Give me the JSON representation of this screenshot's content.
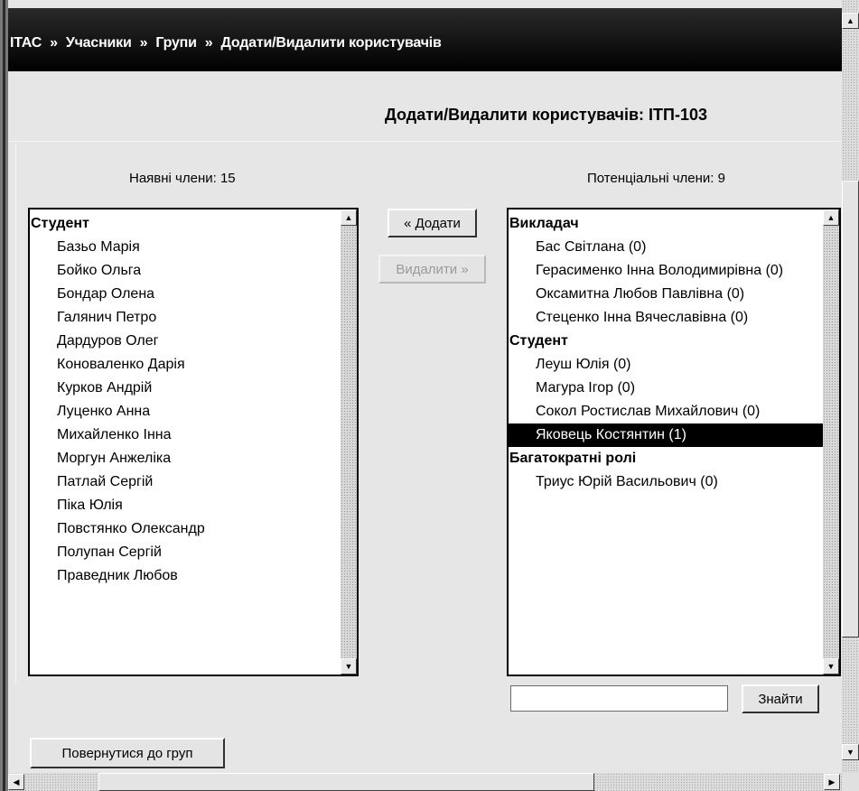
{
  "breadcrumb": {
    "items": [
      "ІТАС",
      "Учасники",
      "Групи",
      "Додати/Видалити користувачів"
    ],
    "separator": "»"
  },
  "page_title": "Додати/Видалити користувачів: ІТП-103",
  "existing": {
    "caption": "Наявні члени: 15",
    "groups": [
      {
        "label": "Студент",
        "members": [
          "Базьо Марія",
          "Бойко Ольга",
          "Бондар Олена",
          "Галянич Петро",
          "Дардуров Олег",
          "Коноваленко Дарія",
          "Курков Андрій",
          "Луценко Анна",
          "Михайленко Інна",
          "Моргун Анжеліка",
          "Патлай Сергій",
          "Піка Юлія",
          "Повстянко Олександр",
          "Полупан Сергій",
          "Праведник Любов"
        ]
      }
    ]
  },
  "potential": {
    "caption": "Потенціальні члени: 9",
    "groups": [
      {
        "label": "Викладач",
        "members": [
          "Бас Світлана (0)",
          "Герасименко Інна Володимирівна (0)",
          "Оксамитна Любов Павлівна (0)",
          "Стеценко Інна Вячеславівна (0)"
        ]
      },
      {
        "label": "Студент",
        "members": [
          "Леуш Юлія (0)",
          "Магура Ігор (0)",
          "Сокол Ростислав Михайлович (0)",
          "Яковець Костянтин (1)"
        ]
      },
      {
        "label": "Багатократні ролі",
        "members": [
          "Триус Юрій Васильович (0)"
        ]
      }
    ],
    "selected": "Яковець Костянтин (1)"
  },
  "buttons": {
    "add": "« Додати",
    "remove": "Видалити »",
    "search": "Знайти",
    "back": "Повернутися до груп"
  },
  "search": {
    "value": ""
  },
  "icons": {
    "scroll_up": "triangle-up-icon",
    "scroll_down": "triangle-down-icon",
    "scroll_left": "triangle-left-icon",
    "scroll_right": "triangle-right-icon"
  },
  "colors": {
    "navbar": "#000000",
    "background": "#e6e6e6",
    "selection": "#000000"
  }
}
